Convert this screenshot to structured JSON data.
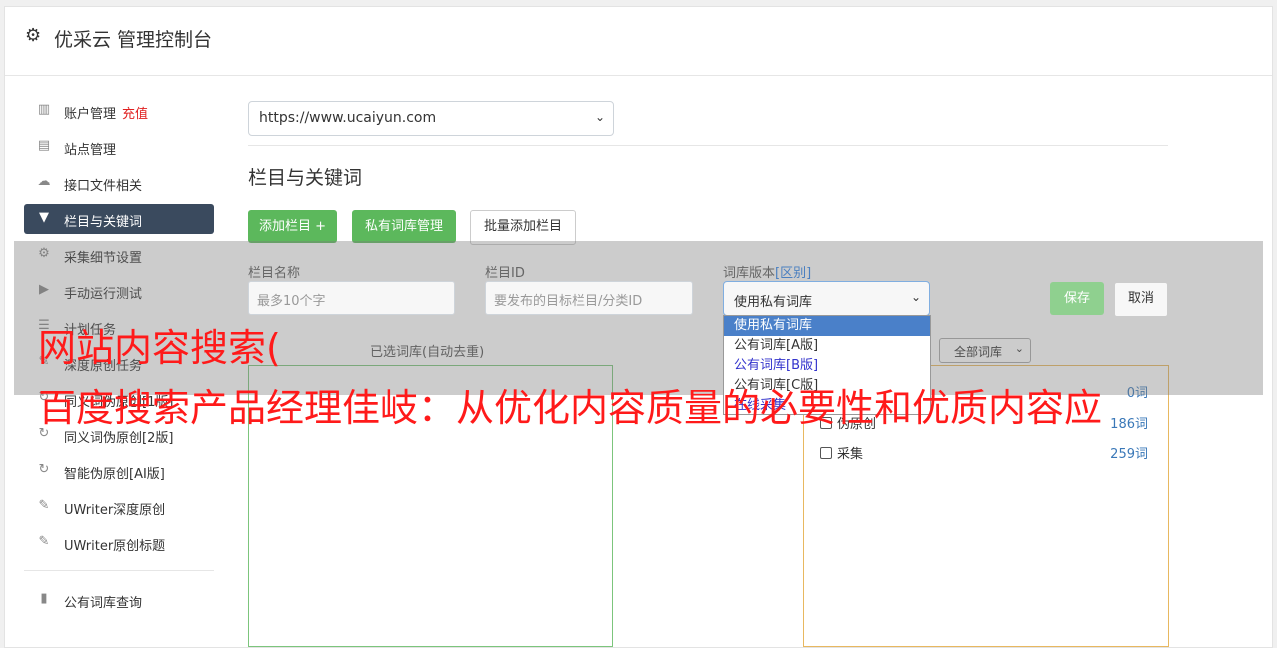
{
  "header": {
    "title": "优采云 管理控制台",
    "icon": "gear-icon"
  },
  "sidebar": {
    "items": [
      {
        "label": "账户管理",
        "extra": "充值",
        "icon": "bar-chart-icon"
      },
      {
        "label": "站点管理",
        "icon": "server-icon"
      },
      {
        "label": "接口文件相关",
        "icon": "cloud-upload-icon"
      },
      {
        "label": "栏目与关键词",
        "icon": "filter-icon",
        "active": true
      },
      {
        "label": "采集细节设置",
        "icon": "cogs-icon"
      },
      {
        "label": "手动运行测试",
        "icon": "play-circle-icon"
      },
      {
        "label": "计划任务",
        "icon": "list-icon"
      },
      {
        "label": "深度原创任务",
        "icon": "edit-icon"
      },
      {
        "label": "同义词伪原创[1版]",
        "icon": "refresh-icon"
      },
      {
        "label": "同义词伪原创[2版]",
        "icon": "refresh-icon"
      },
      {
        "label": "智能伪原创[AI版]",
        "icon": "refresh-icon"
      },
      {
        "label": "UWriter深度原创",
        "icon": "edit-icon"
      },
      {
        "label": "UWriter原创标题",
        "icon": "edit-icon"
      }
    ],
    "bottom_items": [
      {
        "label": "公有词库查询",
        "icon": "book-icon"
      }
    ]
  },
  "main": {
    "site_select": "https://www.ucaiyun.com",
    "section_title": "栏目与关键词",
    "buttons": {
      "add_column": "添加栏目 +",
      "private_lib": "私有词库管理",
      "batch_add": "批量添加栏目"
    },
    "form": {
      "name_label": "栏目名称",
      "name_placeholder": "最多10个字",
      "id_label": "栏目ID",
      "id_placeholder": "要发布的目标栏目/分类ID",
      "version_label": "词库版本",
      "version_link": "[区别]",
      "version_value": "使用私有词库",
      "version_options": [
        "使用私有词库",
        "公有词库[A版]",
        "公有词库[B版]",
        "公有词库[C版]",
        "在线采集"
      ],
      "save": "保存",
      "cancel": "取消"
    },
    "selected_lib_title": "已选词库(自动去重)",
    "lib_filter": "全部词库",
    "libraries": [
      {
        "name": "",
        "count": "0词"
      },
      {
        "name": "伪原创",
        "count": "186词"
      },
      {
        "name": "采集",
        "count": "259词"
      }
    ]
  },
  "watermark": {
    "line1": "网站内容搜索(",
    "line2": "百度搜索产品经理佳岐：从优化内容质量的必要性和优质内容应"
  },
  "colors": {
    "green": "#5cb85c",
    "active_nav": "#3a4a5e",
    "watermark": "#ff1a1a",
    "link": "#3a78b8"
  }
}
